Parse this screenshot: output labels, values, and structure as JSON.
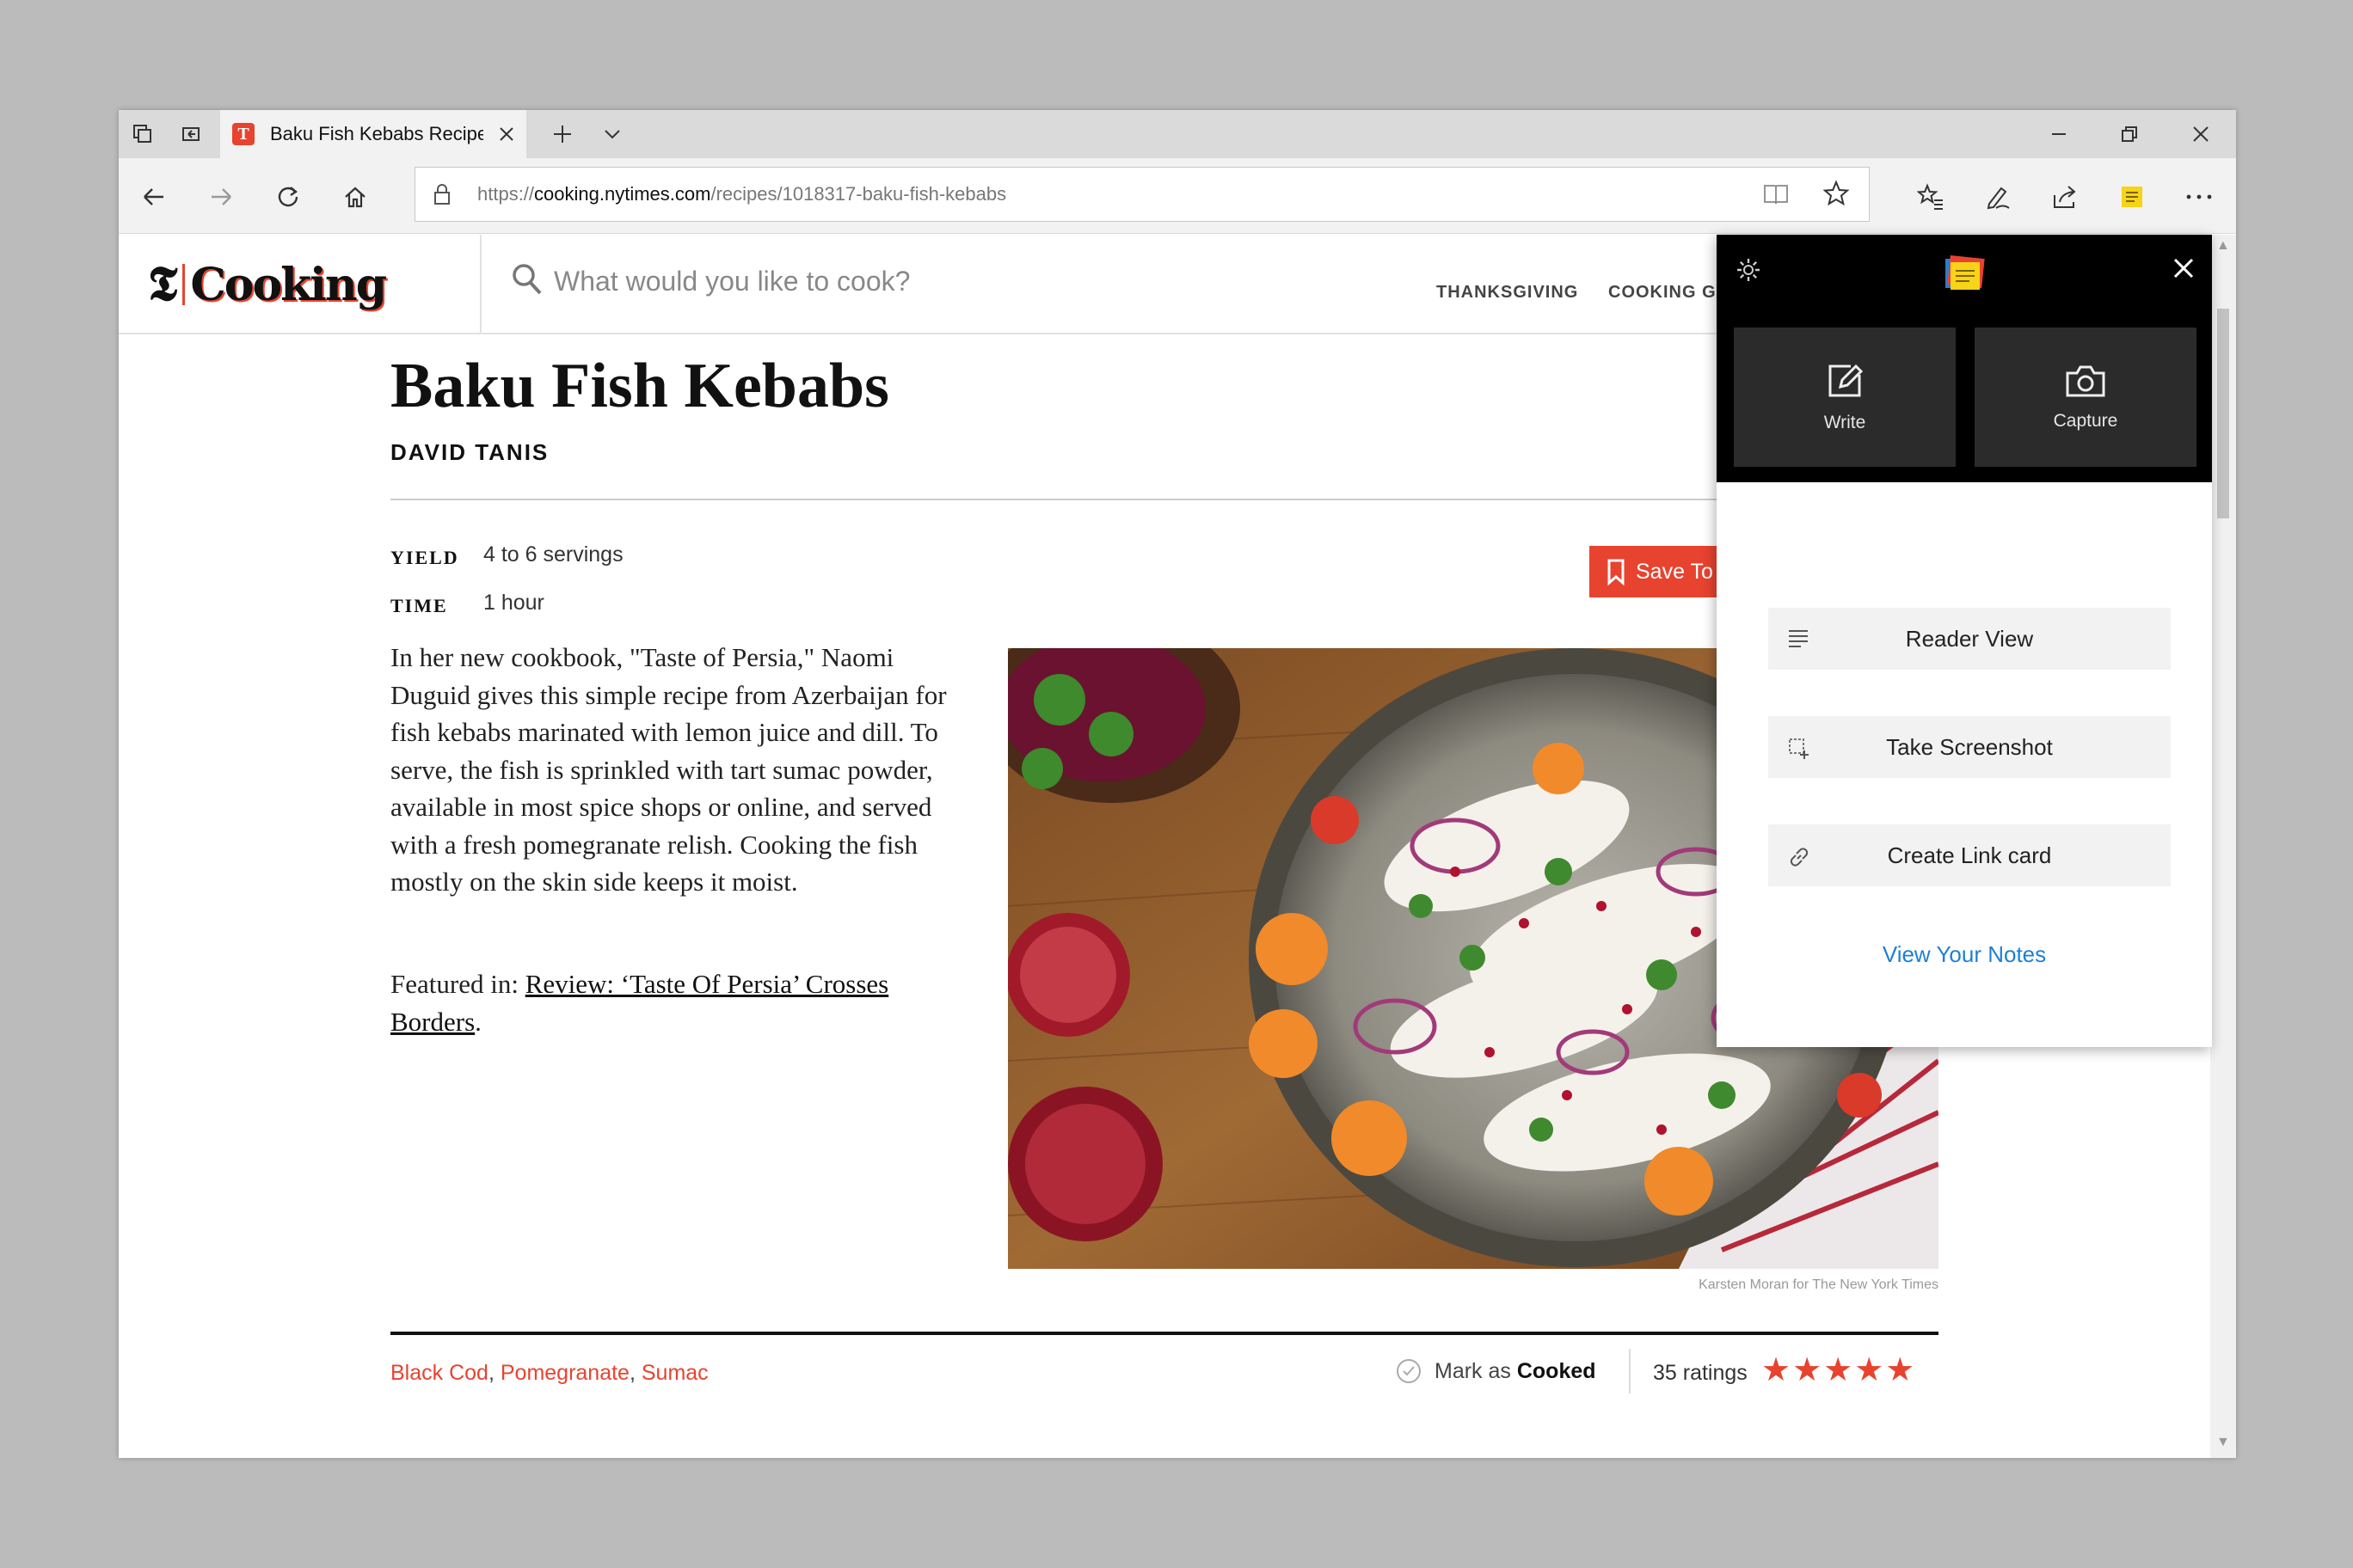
{
  "browser": {
    "tab_title": "Baku Fish Kebabs Recipe",
    "url_prefix": "https://",
    "url_domain": "cooking.nytimes.com",
    "url_path": "/recipes/1018317-baku-fish-kebabs"
  },
  "site": {
    "logo_mark": "𝕿",
    "logo_word": "Cooking",
    "search_placeholder": "What would you like to cook?",
    "nav": [
      "THANKSGIVING",
      "COOKING G"
    ]
  },
  "recipe": {
    "title": "Baku Fish Kebabs",
    "author": "DAVID TANIS",
    "yield_label": "YIELD",
    "yield_value": "4 to 6 servings",
    "time_label": "TIME",
    "time_value": "1 hour",
    "save_label": "Save To",
    "intro": "In her new cookbook, \"Taste of Persia,\" Naomi Duguid gives this simple recipe from Azerbaijan for fish kebabs marinated with lemon juice and dill. To serve, the fish is sprinkled with tart sumac powder, available in most spice shops or online, and served with a fresh pomegranate relish. Cooking the fish mostly on the skin side keeps it moist.",
    "featured_prefix": "Featured in: ",
    "featured_link": "Review: ‘Taste Of Persia’ Crosses Borders",
    "featured_suffix": ".",
    "photo_credit": "Karsten Moran for The New York Times",
    "tags": [
      "Black Cod",
      "Pomegranate",
      "Sumac"
    ],
    "mark_as": "Mark as",
    "cooked": "Cooked",
    "ratings": "35 ratings",
    "stars": "★★★★★",
    "star_rating": 5
  },
  "onenote": {
    "write": "Write",
    "capture": "Capture",
    "reader_view": "Reader View",
    "take_screenshot": "Take Screenshot",
    "create_link_card": "Create Link card",
    "view_notes": "View Your Notes"
  },
  "colors": {
    "accent": "#e8432f",
    "link_blue": "#1e7fd6",
    "panel_dark": "#000000"
  }
}
